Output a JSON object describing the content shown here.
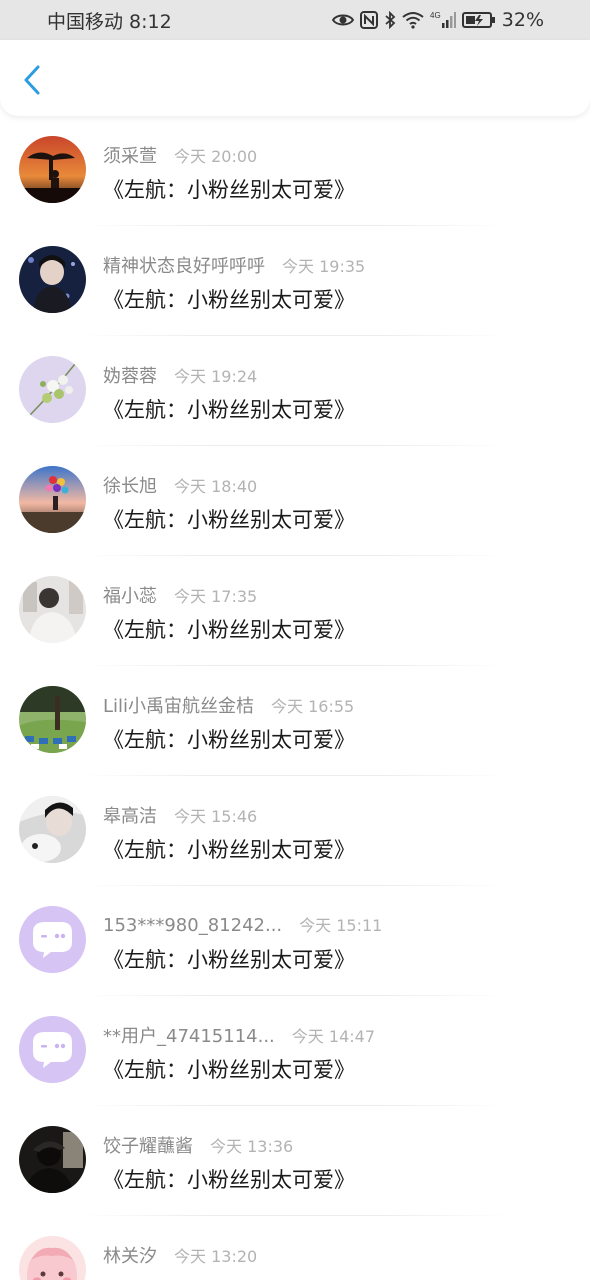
{
  "status_bar": {
    "carrier_time": "中国移动 8:12",
    "network_label": "4G",
    "battery": "32%",
    "icons": [
      "eye-icon",
      "nfc-icon",
      "bluetooth-icon",
      "wifi-icon",
      "signal-icon",
      "battery-icon"
    ]
  },
  "nav": {
    "back_icon": "chevron-left-icon",
    "accent_color": "#2b9de0"
  },
  "comments": [
    {
      "name": "须采萱",
      "time": "今天 20:00",
      "text": "《左航：小粉丝别太可爱》"
    },
    {
      "name": "精神状态良好呼呼呼",
      "time": "今天 19:35",
      "text": "《左航：小粉丝别太可爱》"
    },
    {
      "name": "妫蓉蓉",
      "time": "今天 19:24",
      "text": "《左航：小粉丝别太可爱》"
    },
    {
      "name": "徐长旭",
      "time": "今天 18:40",
      "text": "《左航：小粉丝别太可爱》"
    },
    {
      "name": "福小蕊",
      "time": "今天 17:35",
      "text": "《左航：小粉丝别太可爱》"
    },
    {
      "name": "Lili小禹宙航丝金桔",
      "time": "今天 16:55",
      "text": "《左航：小粉丝别太可爱》"
    },
    {
      "name": "皋高洁",
      "time": "今天 15:46",
      "text": "《左航：小粉丝别太可爱》"
    },
    {
      "name": "153***980_81242...",
      "time": "今天 15:11",
      "text": "《左航：小粉丝别太可爱》"
    },
    {
      "name": "**用户_47415114...",
      "time": "今天 14:47",
      "text": "《左航：小粉丝别太可爱》"
    },
    {
      "name": "饺子耀蘸酱",
      "time": "今天 13:36",
      "text": "《左航：小粉丝别太可爱》"
    },
    {
      "name": "林关汐",
      "time": "今天 13:20",
      "text": ""
    }
  ]
}
